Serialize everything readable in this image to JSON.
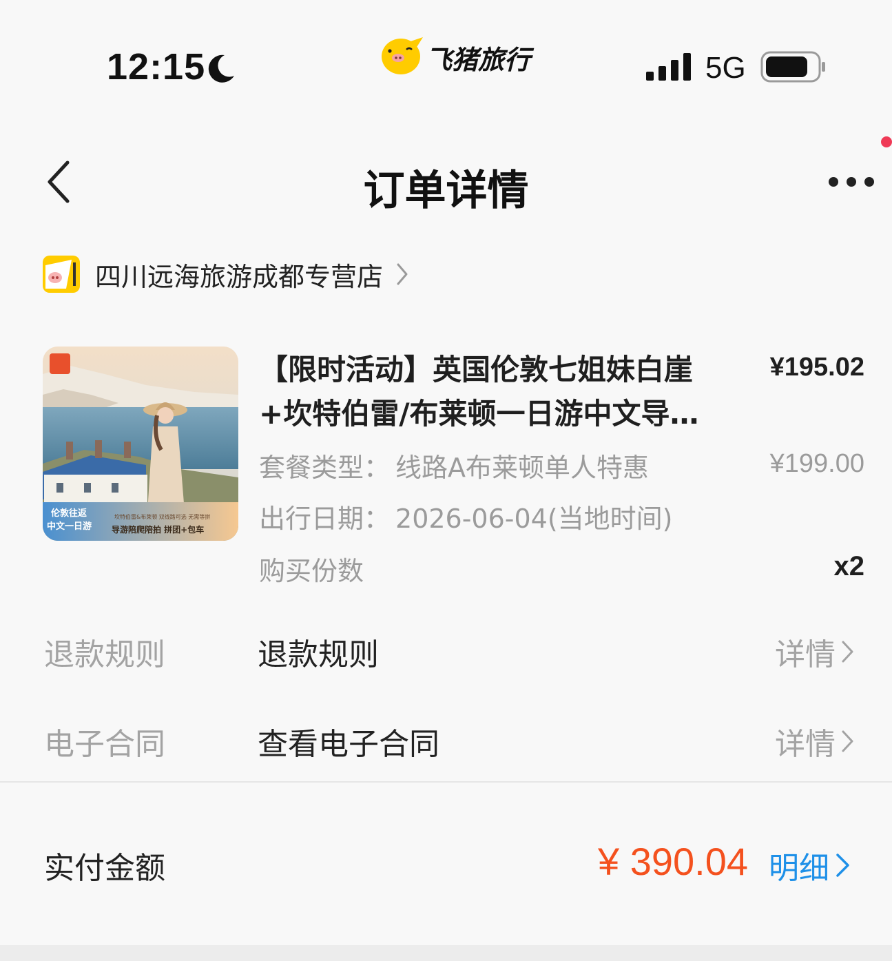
{
  "status_bar": {
    "time": "12:15",
    "network": "5G",
    "icons": [
      "moon-icon",
      "signal-icon",
      "battery-icon"
    ]
  },
  "brand": {
    "name": "飞猪旅行",
    "color": "#ffcc00"
  },
  "nav": {
    "title": "订单详情",
    "icons": [
      "back-icon",
      "more-icon"
    ]
  },
  "shop": {
    "name": "四川远海旅游成都专营店"
  },
  "product": {
    "title": "【限时活动】英国伦敦七姐妹白崖+坎特伯雷/布莱顿一日游中文导游陪爬陪拍拼团+包车",
    "price": "¥195.02",
    "image_badge": "伦敦往返 中文一日游",
    "image_caption": "导游陪爬陪拍 拼团+包车",
    "image_tagline": "坎特伯雷&布莱顿 双线路可选 无需等拼",
    "package_label": "套餐类型：",
    "package_value": "线路A布莱顿单人特惠",
    "package_price": "¥199.00",
    "date_label": "出行日期：",
    "date_value": "2026-06-04(当地时间)",
    "quantity_label": "购买份数",
    "quantity_value": "x2"
  },
  "refund": {
    "label": "退款规则",
    "value": "退款规则",
    "link": "详情"
  },
  "contract": {
    "label": "电子合同",
    "value": "查看电子合同",
    "link": "详情"
  },
  "total": {
    "label": "实付金额",
    "amount": "¥ 390.04",
    "detail_link": "明细"
  },
  "colors": {
    "accent_orange": "#f4511e",
    "link_blue": "#1e90e8",
    "notify_red": "#ef3a56",
    "muted_text": "#a3a3a3"
  }
}
